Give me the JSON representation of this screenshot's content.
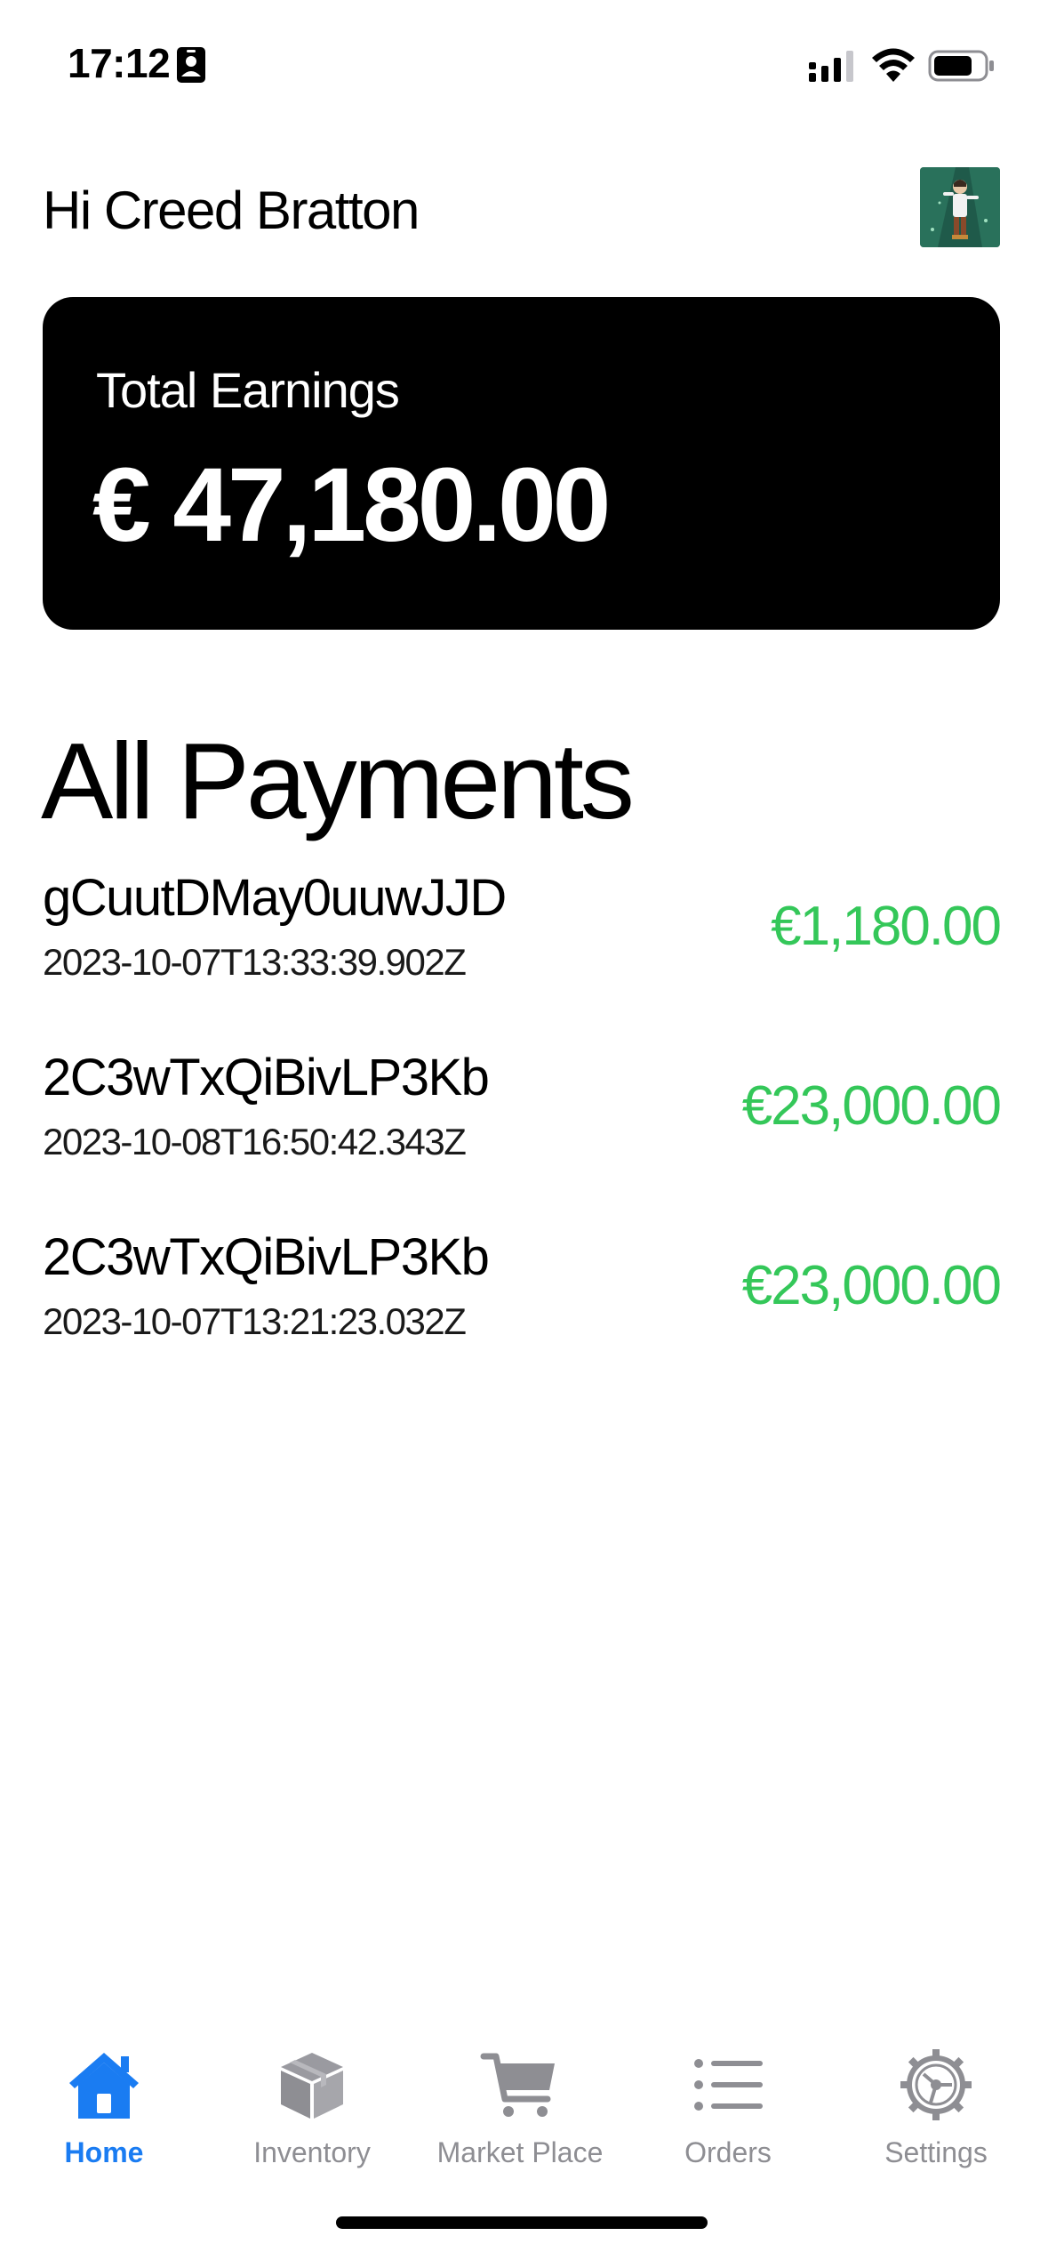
{
  "status_bar": {
    "time": "17:12",
    "icons": [
      "id-card-icon",
      "cellular-signal-icon",
      "wifi-icon",
      "battery-icon"
    ]
  },
  "header": {
    "greeting": "Hi Creed Bratton",
    "avatar_icon": "avatar-image"
  },
  "earnings": {
    "label": "Total Earnings",
    "amount": "€ 47,180.00"
  },
  "payments": {
    "title": "All Payments",
    "items": [
      {
        "id": "gCuutDMay0uuwJJD",
        "date": "2023-10-07T13:33:39.902Z",
        "amount": "€1,180.00"
      },
      {
        "id": "2C3wTxQiBivLP3Kb",
        "date": "2023-10-08T16:50:42.343Z",
        "amount": "€23,000.00"
      },
      {
        "id": "2C3wTxQiBivLP3Kb",
        "date": "2023-10-07T13:21:23.032Z",
        "amount": "€23,000.00"
      }
    ]
  },
  "tab_bar": {
    "items": [
      {
        "label": "Home",
        "icon": "home-icon",
        "active": true
      },
      {
        "label": "Inventory",
        "icon": "box-icon",
        "active": false
      },
      {
        "label": "Market Place",
        "icon": "cart-icon",
        "active": false
      },
      {
        "label": "Orders",
        "icon": "list-icon",
        "active": false
      },
      {
        "label": "Settings",
        "icon": "gear-icon",
        "active": false
      }
    ]
  },
  "colors": {
    "accent": "#1a7cf2",
    "positive_amount": "#34c759",
    "card_background": "#000000",
    "inactive_tab": "#8e8e93"
  }
}
